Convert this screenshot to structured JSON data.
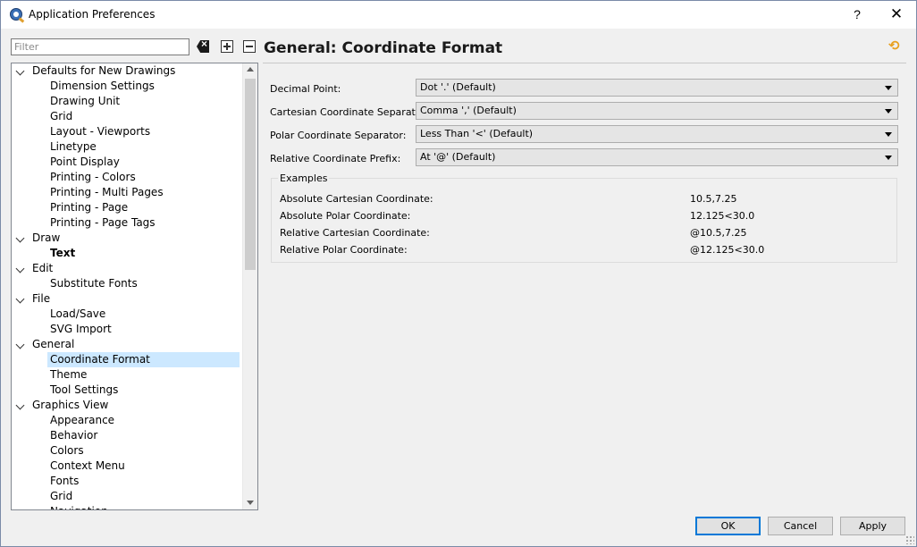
{
  "window": {
    "title": "Application Preferences",
    "help_glyph": "?",
    "close_glyph": "✕"
  },
  "filter": {
    "placeholder": "Filter",
    "value": ""
  },
  "tree": [
    {
      "label": "Defaults for New Drawings",
      "level": 0,
      "expanded": true
    },
    {
      "label": "Dimension Settings",
      "level": 1
    },
    {
      "label": "Drawing Unit",
      "level": 1
    },
    {
      "label": "Grid",
      "level": 1
    },
    {
      "label": "Layout - Viewports",
      "level": 1
    },
    {
      "label": "Linetype",
      "level": 1
    },
    {
      "label": "Point Display",
      "level": 1
    },
    {
      "label": "Printing - Colors",
      "level": 1
    },
    {
      "label": "Printing - Multi Pages",
      "level": 1
    },
    {
      "label": "Printing - Page",
      "level": 1
    },
    {
      "label": "Printing - Page Tags",
      "level": 1
    },
    {
      "label": "Draw",
      "level": 0,
      "expanded": true
    },
    {
      "label": "Text",
      "level": 1,
      "bold": true
    },
    {
      "label": "Edit",
      "level": 0,
      "expanded": true
    },
    {
      "label": "Substitute Fonts",
      "level": 1
    },
    {
      "label": "File",
      "level": 0,
      "expanded": true
    },
    {
      "label": "Load/Save",
      "level": 1
    },
    {
      "label": "SVG Import",
      "level": 1
    },
    {
      "label": "General",
      "level": 0,
      "expanded": true
    },
    {
      "label": "Coordinate Format",
      "level": 1,
      "selected": true
    },
    {
      "label": "Theme",
      "level": 1
    },
    {
      "label": "Tool Settings",
      "level": 1
    },
    {
      "label": "Graphics View",
      "level": 0,
      "expanded": true
    },
    {
      "label": "Appearance",
      "level": 1
    },
    {
      "label": "Behavior",
      "level": 1
    },
    {
      "label": "Colors",
      "level": 1
    },
    {
      "label": "Context Menu",
      "level": 1
    },
    {
      "label": "Fonts",
      "level": 1
    },
    {
      "label": "Grid",
      "level": 1
    },
    {
      "label": "Navigation",
      "level": 1
    }
  ],
  "page": {
    "title": "General: Coordinate Format"
  },
  "settings": [
    {
      "label": "Decimal Point:",
      "value": "Dot '.' (Default)"
    },
    {
      "label": "Cartesian Coordinate Separator:",
      "value": "Comma ',' (Default)"
    },
    {
      "label": "Polar Coordinate Separator:",
      "value": "Less Than '<' (Default)"
    },
    {
      "label": "Relative Coordinate Prefix:",
      "value": "At '@' (Default)"
    }
  ],
  "examples": {
    "title": "Examples",
    "rows": [
      {
        "label": "Absolute Cartesian Coordinate:",
        "value": "10.5,7.25"
      },
      {
        "label": "Absolute Polar Coordinate:",
        "value": "12.125<30.0"
      },
      {
        "label": "Relative Cartesian Coordinate:",
        "value": "@10.5,7.25"
      },
      {
        "label": "Relative Polar Coordinate:",
        "value": "@12.125<30.0"
      }
    ]
  },
  "buttons": {
    "ok": "OK",
    "cancel": "Cancel",
    "apply": "Apply"
  },
  "colors": {
    "selection": "#cce8ff",
    "default_button_border": "#0078d7",
    "reset_icon": "#e8a020"
  }
}
